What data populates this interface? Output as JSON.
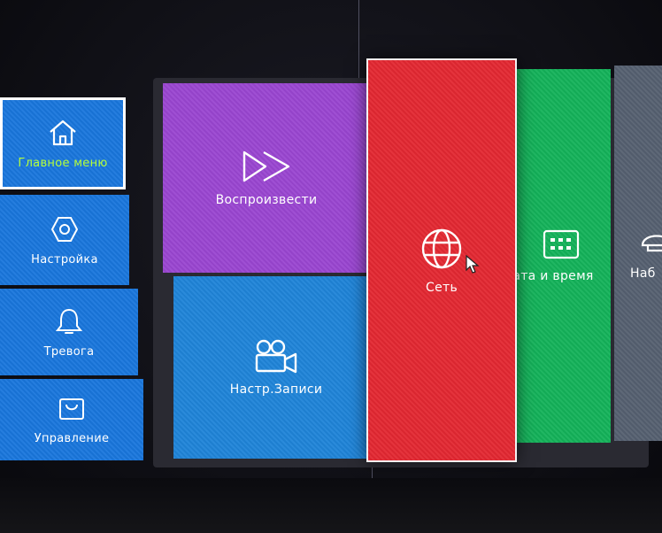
{
  "sidebar": {
    "items": [
      {
        "label": "Главное меню",
        "icon": "home-icon"
      },
      {
        "label": "Настройка",
        "icon": "gear-icon"
      },
      {
        "label": "Тревога",
        "icon": "bell-icon"
      },
      {
        "label": "Управление",
        "icon": "bag-icon"
      }
    ]
  },
  "tiles": {
    "playback": {
      "label": "Воспроизвести",
      "icon": "fast-forward-icon"
    },
    "record": {
      "label": "Настр.Записи",
      "icon": "video-camera-icon"
    },
    "network": {
      "label": "Сеть",
      "icon": "globe-icon"
    },
    "datetime": {
      "label": "ата и время",
      "icon": "calendar-icon"
    },
    "monitor": {
      "label": "Наб",
      "icon": "dome-camera-icon"
    }
  },
  "colors": {
    "playback": "#9a46d1",
    "record": "#1f84d8",
    "network": "#e32832",
    "datetime": "#14b25a",
    "monitor": "#556070",
    "sidebar": "#1976dc",
    "selected_label": "#b6ff3a"
  }
}
